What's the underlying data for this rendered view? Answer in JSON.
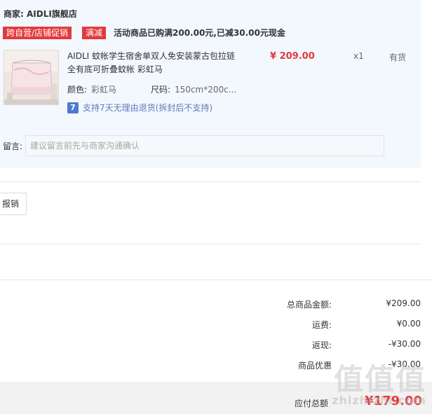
{
  "shop": {
    "label": "商家:",
    "name": "AIDLI旗舰店"
  },
  "tags": [
    "跨自营/店铺促销",
    "满减"
  ],
  "promo": {
    "text": "活动商品已购满200.00元,已减30.00元现金"
  },
  "product": {
    "name": "AIDLI 蚊帐学生宿舍单双人免安装蒙古包拉链全有底可折叠蚊帐 彩虹马",
    "price": "¥ 209.00",
    "quantity": "x1",
    "stock": "有货",
    "color_label": "颜色:",
    "color_value": "彩虹马",
    "size_label": "尺码:",
    "size_value": "150cm*200c...",
    "return_icon": "7",
    "return_policy": "支持7天无理由退货(拆封后不支持)"
  },
  "note": {
    "label": "留言:",
    "placeholder": "建议留言前先与商家沟通确认"
  },
  "reimburse_button": "报销",
  "summary": [
    {
      "label": "总商品金额:",
      "value": "¥209.00"
    },
    {
      "label": "运费:",
      "value": "¥0.00"
    },
    {
      "label": "返现:",
      "value": "-¥30.00"
    },
    {
      "label": "商品优惠",
      "value": "-¥30.00"
    }
  ],
  "payment": {
    "label": "应付总额",
    "value": "¥179.00"
  },
  "watermark": {
    "main": "值值值",
    "sub": "zhizhizhi.com"
  },
  "colors": {
    "accent_red": "#e4393c",
    "panel_blue": "#f3f8fe",
    "link_blue": "#5b7bbd"
  }
}
